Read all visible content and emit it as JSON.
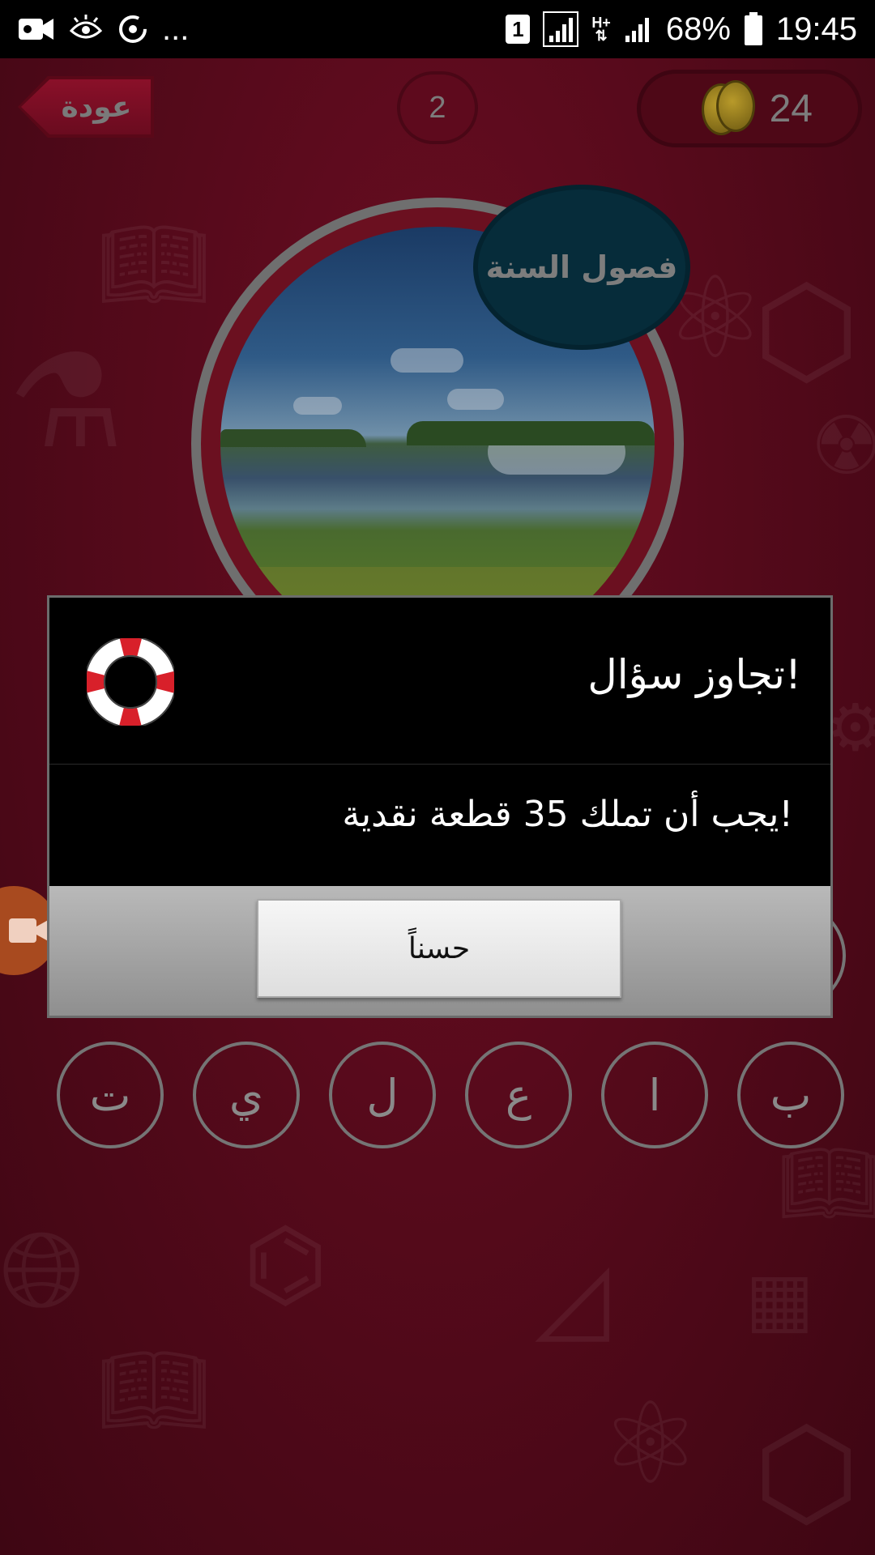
{
  "status_bar": {
    "left_more": "...",
    "sim_slot": "1",
    "network_type": "H+",
    "battery": "68%",
    "time": "19:45"
  },
  "top_bar": {
    "back_label": "عودة",
    "level": "2",
    "coins": "24"
  },
  "question": {
    "category": "فصول السنة"
  },
  "letters_row": [
    "ت",
    "ي",
    "ل",
    "ع",
    "ا",
    "ب"
  ],
  "dialog": {
    "title": "تجاوز سؤال!",
    "message": "يجب أن تملك 35 قطعة نقدية!",
    "ok_label": "حسناً"
  },
  "colors": {
    "background": "#560a1b",
    "dialog_header": "#000000",
    "category_bubble": "#062c3a",
    "record_button": "#a84a1f"
  },
  "icons": [
    "video-camera-icon",
    "eye-comfort-icon",
    "sync-icon",
    "sim-card-icon",
    "signal-icon",
    "battery-icon",
    "coin-icon",
    "lifebuoy-icon",
    "undo-icon",
    "question-icon",
    "bomb-icon",
    "hint-icon"
  ]
}
